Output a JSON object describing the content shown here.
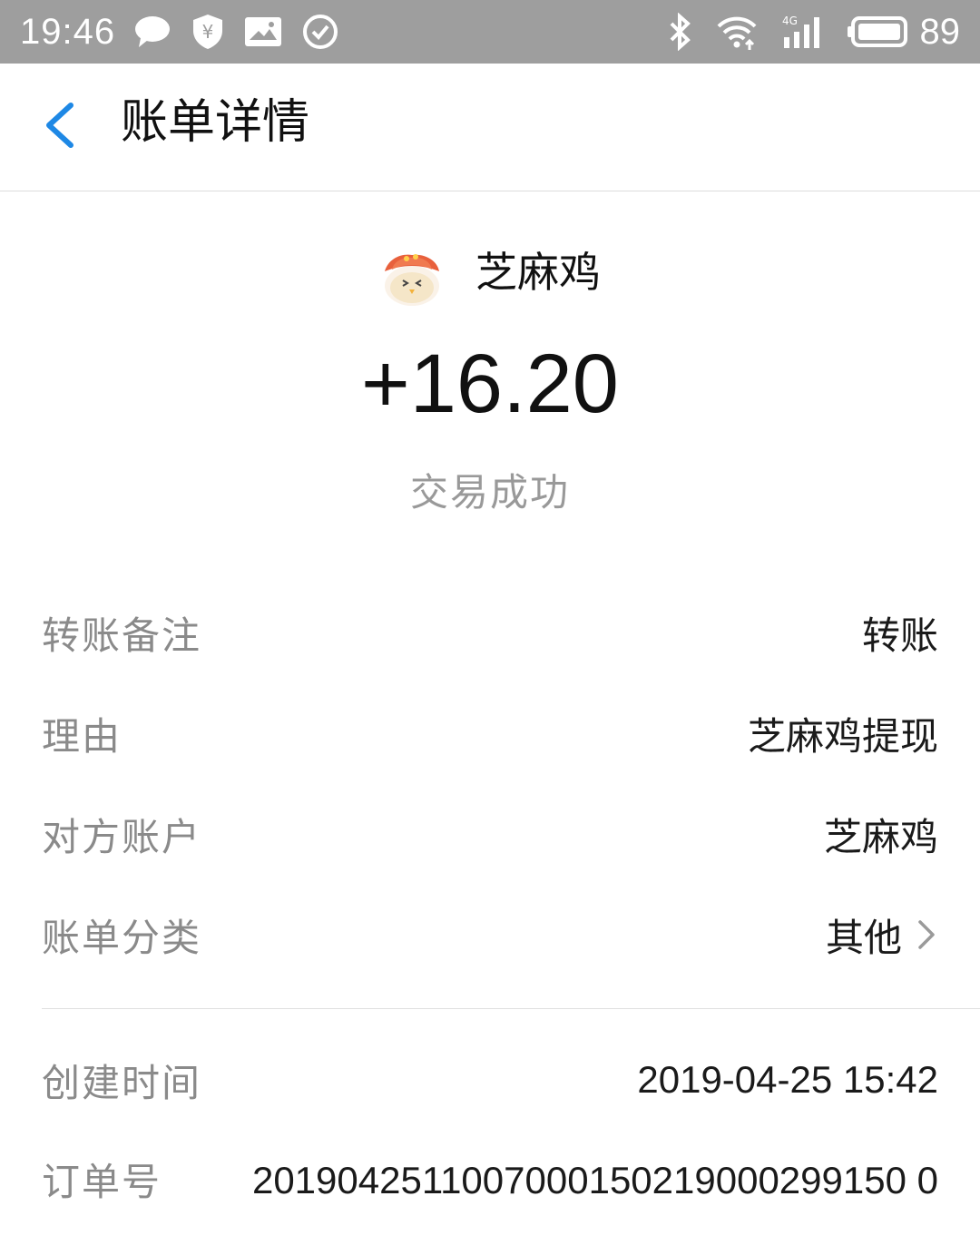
{
  "status_bar": {
    "time": "19:46",
    "battery": "89",
    "network": "4G",
    "icons": [
      "message-icon",
      "shield-yen-icon",
      "image-icon",
      "check-circle-icon",
      "bluetooth-icon",
      "wifi-icon",
      "signal-icon",
      "battery-icon"
    ]
  },
  "header": {
    "back_icon": "chevron-left-icon",
    "title": "账单详情"
  },
  "merchant": {
    "name": "芝麻鸡",
    "logo": "chicken-with-hat-logo"
  },
  "amount": "+16.20",
  "status": "交易成功",
  "details": [
    {
      "label": "转账备注",
      "value": "转账"
    },
    {
      "label": "理由",
      "value": "芝麻鸡提现"
    },
    {
      "label": "对方账户",
      "value": "芝麻鸡"
    },
    {
      "label": "账单分类",
      "value": "其他"
    }
  ],
  "created": {
    "label": "创建时间",
    "value": "2019-04-25 15:42"
  },
  "order": {
    "label": "订单号",
    "value": "2019042511007000150219000299150 0"
  },
  "colors": {
    "status_bar": "#9e9e9e",
    "back_arrow": "#1e88e5",
    "label": "#8a8a8a",
    "status_text": "#999999"
  }
}
